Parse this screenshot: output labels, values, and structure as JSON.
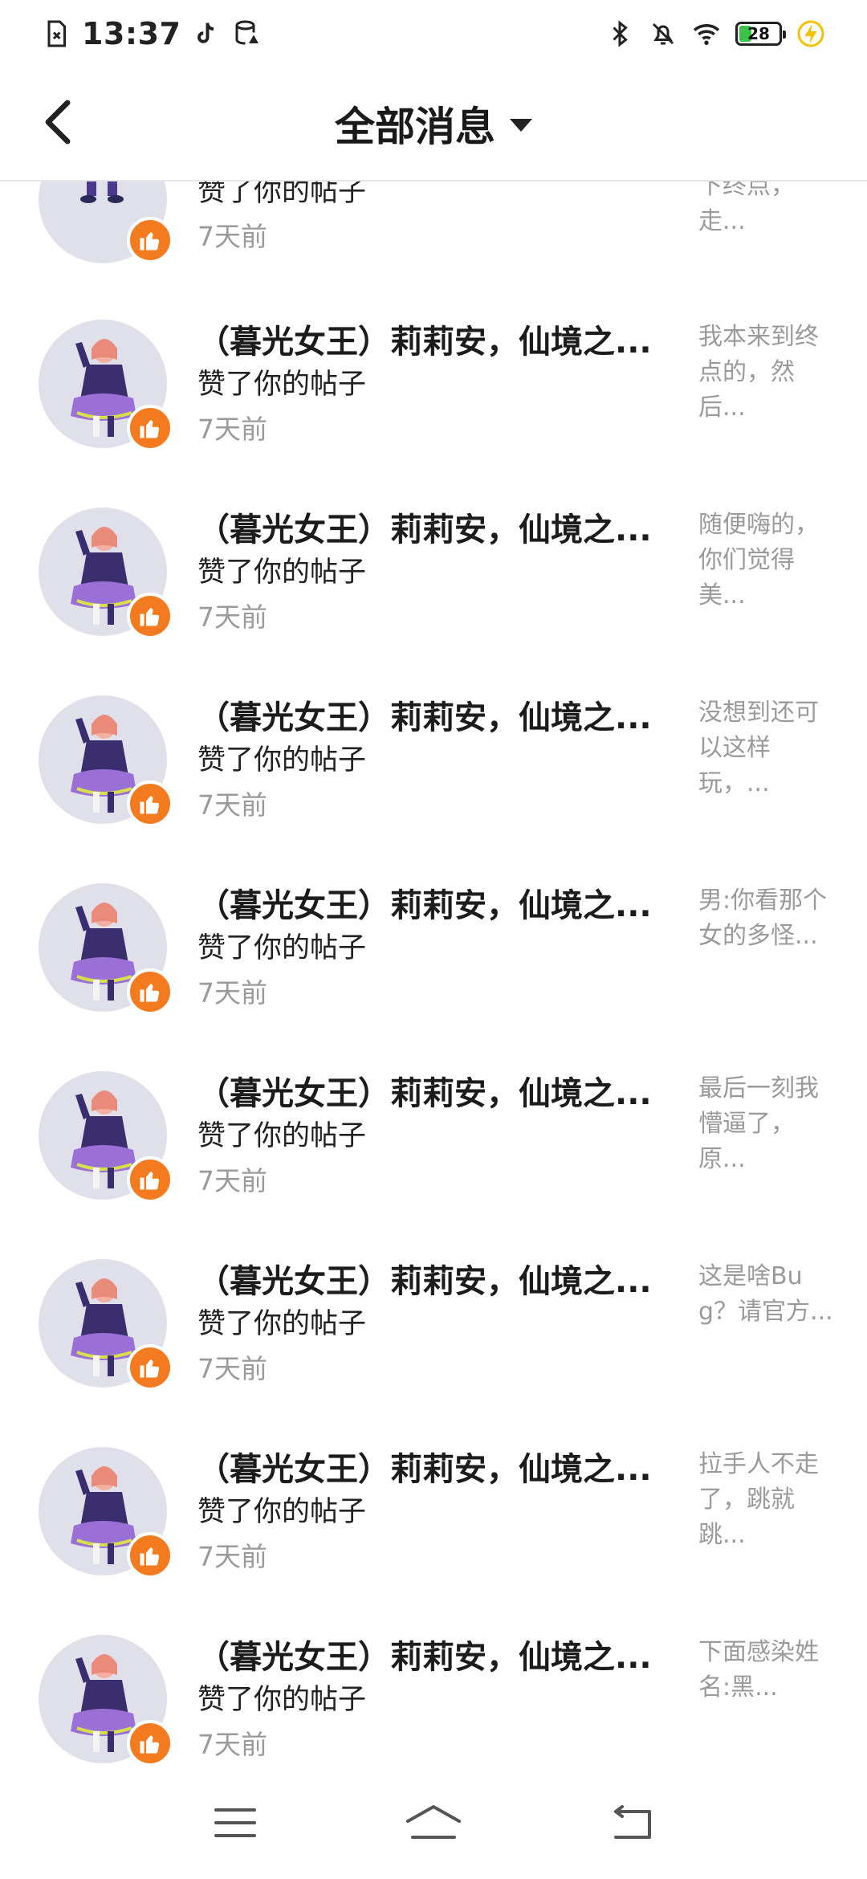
{
  "status_bar": {
    "time": "13:37",
    "battery_level": "28",
    "battery_fraction": 0.28,
    "icons": [
      "sim-error-icon",
      "tiktok-icon",
      "data-saver-icon",
      "bluetooth-icon",
      "mute-icon",
      "wifi-icon",
      "battery-icon",
      "charging-icon"
    ]
  },
  "header": {
    "title": "全部消息",
    "back_icon": "chevron-left-icon",
    "dropdown_icon": "caret-down-icon"
  },
  "partial_item": {
    "action": "赞了你的帖子",
    "time": "7天前",
    "preview": "下终点，走..."
  },
  "notifications": [
    {
      "title": "（暮光女王）莉莉安，仙境之...",
      "action": "赞了你的帖子",
      "time": "7天前",
      "preview": "我本来到终点的，然后..."
    },
    {
      "title": "（暮光女王）莉莉安，仙境之...",
      "action": "赞了你的帖子",
      "time": "7天前",
      "preview": "随便嗨的，你们觉得美..."
    },
    {
      "title": "（暮光女王）莉莉安，仙境之...",
      "action": "赞了你的帖子",
      "time": "7天前",
      "preview": "没想到还可以这样玩，..."
    },
    {
      "title": "（暮光女王）莉莉安，仙境之...",
      "action": "赞了你的帖子",
      "time": "7天前",
      "preview": "男:你看那个女的多怪..."
    },
    {
      "title": "（暮光女王）莉莉安，仙境之...",
      "action": "赞了你的帖子",
      "time": "7天前",
      "preview": "最后一刻我懵逼了，原..."
    },
    {
      "title": "（暮光女王）莉莉安，仙境之...",
      "action": "赞了你的帖子",
      "time": "7天前",
      "preview": "这是啥Bug？请官方..."
    },
    {
      "title": "（暮光女王）莉莉安，仙境之...",
      "action": "赞了你的帖子",
      "time": "7天前",
      "preview": "拉手人不走了，跳就跳..."
    },
    {
      "title": "（暮光女王）莉莉安，仙境之...",
      "action": "赞了你的帖子",
      "time": "7天前",
      "preview": "下面感染姓名:黑..."
    }
  ],
  "colors": {
    "like_badge": "#f47a1f",
    "avatar_bg": "#dfe0ea",
    "muted_text": "#9a9a9a"
  },
  "nav_bar": {
    "icons": [
      "menu-icon",
      "home-icon",
      "back-icon"
    ]
  }
}
